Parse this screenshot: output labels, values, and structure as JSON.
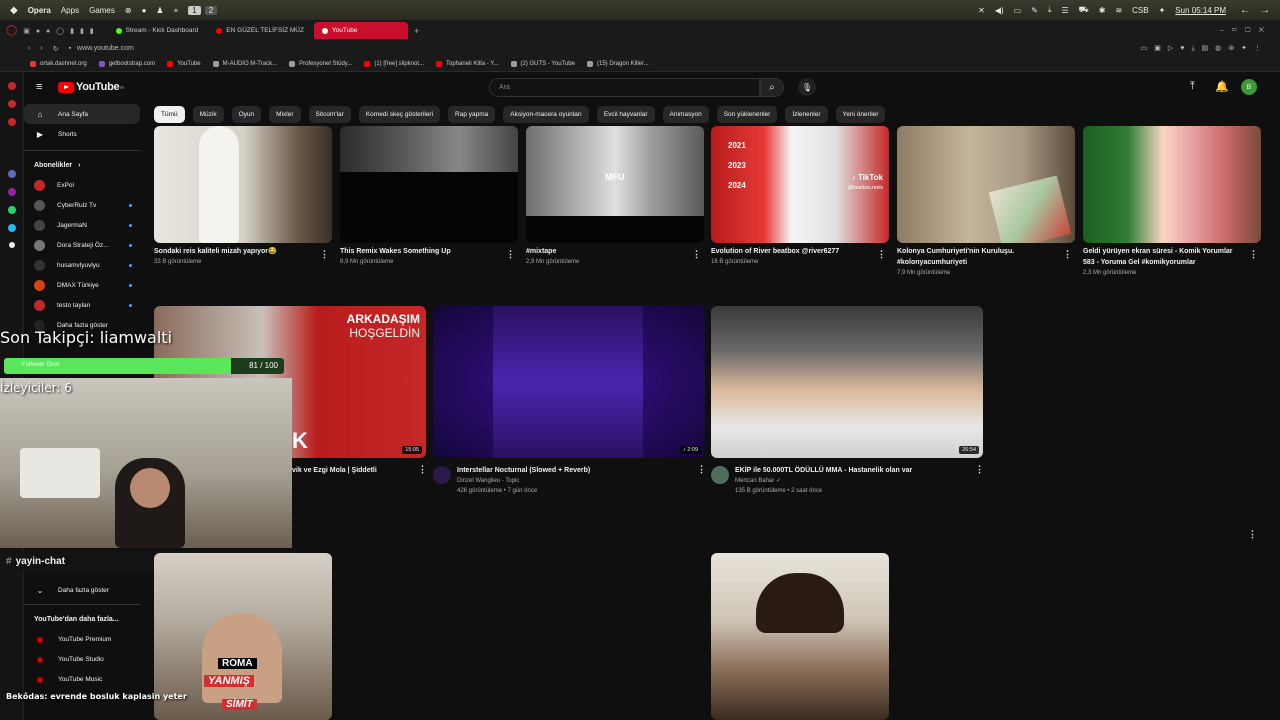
{
  "os": {
    "menu": [
      "Opera",
      "Apps",
      "Games"
    ],
    "vpn_label": "CSB",
    "clock": "Sun 05:14 PM"
  },
  "browser": {
    "tabs": [
      {
        "label": "Stream - Kick Dashboard",
        "color": "#53fc18"
      },
      {
        "label": "EN GÜZEL TELİFSİZ MÜZ",
        "color": "#ff0000"
      },
      {
        "label": "YouTube",
        "color": "#ff0000",
        "active": true
      }
    ],
    "address": "www.youtube.com",
    "bookmarks": [
      "ortak.dashnet.org",
      "getbootstrap.com",
      "YouTube",
      "M-AUDIO M-Track...",
      "Profesyonel Stüdy...",
      "(1) [free] slipknot...",
      "Tophaneli Kitla - Y...",
      "(2) GUTS - YouTube",
      "(15) Dragon Killer..."
    ]
  },
  "yt": {
    "logo_text": "YouTube",
    "logo_region": "TR",
    "search_placeholder": "Ara",
    "avatar_letter": "B"
  },
  "sidebar": {
    "main": [
      {
        "label": "Ana Sayfa",
        "icon": "home-icon",
        "active": true
      },
      {
        "label": "Shorts",
        "icon": "shorts-icon"
      }
    ],
    "subs_header": "Abonelikler",
    "subs": [
      {
        "label": "ExPol",
        "color": "#c62828"
      },
      {
        "label": "CyberRulz Tv",
        "color": "#555555"
      },
      {
        "label": "JagermaN",
        "color": "#444444"
      },
      {
        "label": "Dora Strateji Öz...",
        "color": "#777777"
      },
      {
        "label": "husamvlyuvlyu",
        "color": "#333333"
      },
      {
        "label": "DMAX Türkiye",
        "color": "#d84315"
      },
      {
        "label": "testo taylan",
        "color": "#c62828"
      },
      {
        "label": "Daha fazla göster",
        "color": "#222222"
      }
    ],
    "more_label": "Daha fazla göster",
    "more_header": "YouTube'dan daha fazla...",
    "more_items": [
      "YouTube Premium",
      "YouTube Studio",
      "YouTube Music"
    ]
  },
  "chips": [
    "Tümü",
    "Müzik",
    "Oyun",
    "Mixler",
    "Sitcom'lar",
    "Komedi skeç gösterileri",
    "Rap yapma",
    "Aksiyon-macera oyunları",
    "Evcil hayvanlar",
    "Animasyon",
    "Son yüklenenler",
    "İzlenenler",
    "Yeni öneriler"
  ],
  "row1": [
    {
      "title": "Sondaki reis kaliteli mizah yapıyor😂",
      "meta": "33 B görüntüleme"
    },
    {
      "title": "This Remix Wakes Something Up",
      "meta": "8,9 Mn görüntüleme"
    },
    {
      "title": "#mixtape",
      "meta": "2,9 Mn görüntüleme",
      "thumb_text": "MFU"
    },
    {
      "title": "Evolution of River beatbox @river6277",
      "meta": "16 B görüntüleme",
      "thumb_years": [
        "2021",
        "2023",
        "2024"
      ],
      "thumb_brand": "TikTok",
      "thumb_handle": "@beatbox.reels"
    },
    {
      "title": "Kolonya Cumhuriyeti'nin Kuruluşu. #kolonyacumhuriyeti",
      "meta": "7,9 Mn görüntüleme"
    },
    {
      "title": "Geldi yürüyen ekran süresi - Komik Yorumlar 583 - Yoruma Gel #komikyorumlar",
      "meta": "2,3 Mn görüntüleme"
    }
  ],
  "row2": [
    {
      "title": "vik ve Ezgi Mola | Şiddetli",
      "duration": "15:05",
      "thumb_text": "ARKADAŞIM",
      "thumb_sub": "HOŞGELDİN",
      "thumb_letter": "K"
    },
    {
      "title": "Interstellar Nocturnal (Slowed + Reverb)",
      "channel": "Dinzel Wanglieu - Topic",
      "meta": "426 görüntüleme • 7 gün önce",
      "duration": "♪ 2:09"
    },
    {
      "title": "EKİP ile 50.000TL ÖDÜLLÜ MMA - Hastanelik olan var",
      "channel": "Mertcan Bahar ✓",
      "meta": "135 B görüntüleme • 2 saat önce",
      "duration": "26:54"
    }
  ],
  "overlay": {
    "last_follower": "Son Takipçi: liamwalti",
    "follower_goal_label": "Follower Goal",
    "follower_count": "81 / 100",
    "follower_progress": 0.81,
    "viewers": "İzleyiciler: 6",
    "chat_channel": "yayin-chat",
    "chat_message": "Bekődas: evrende bosluk kaplasin yeter",
    "sticker_top": "ROMA",
    "sticker_mid": "YANMIŞ",
    "sticker_bot": "SİMİT"
  }
}
